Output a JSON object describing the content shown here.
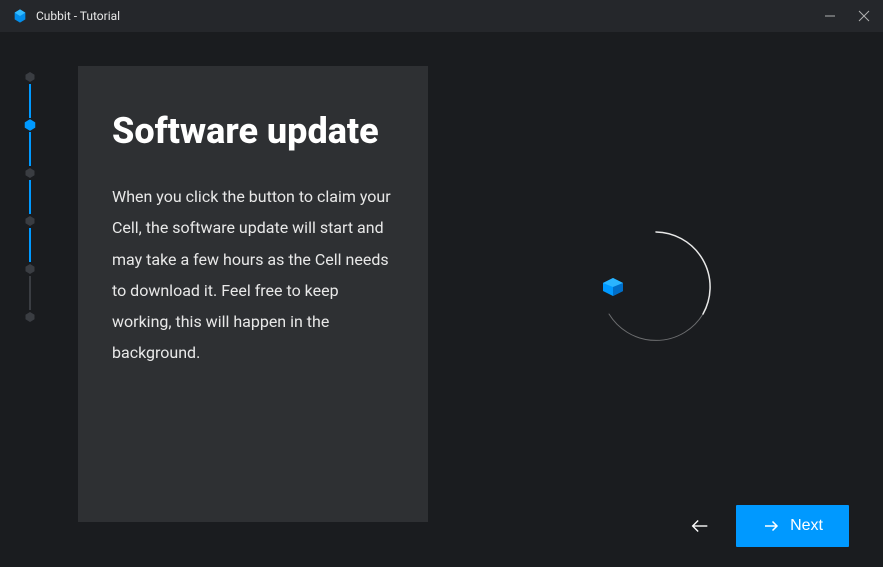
{
  "titlebar": {
    "title": "Cubbit - Tutorial"
  },
  "stepper": {
    "steps": [
      {
        "active": false
      },
      {
        "active": true
      },
      {
        "active": false
      },
      {
        "active": false
      },
      {
        "active": false
      },
      {
        "active": false
      }
    ],
    "connectorColors": [
      "#0099ff",
      "#0099ff",
      "#0099ff",
      "#0099ff",
      "#3a3d42"
    ]
  },
  "panel": {
    "title": "Software update",
    "body": "When you click the button to claim your Cell, the software update will start and may take a few hours as the Cell needs to download it. Feel free to keep working, this will happen in the background."
  },
  "footer": {
    "next_label": "Next"
  },
  "colors": {
    "accent": "#0099ff",
    "inactive": "#3a3d42"
  }
}
